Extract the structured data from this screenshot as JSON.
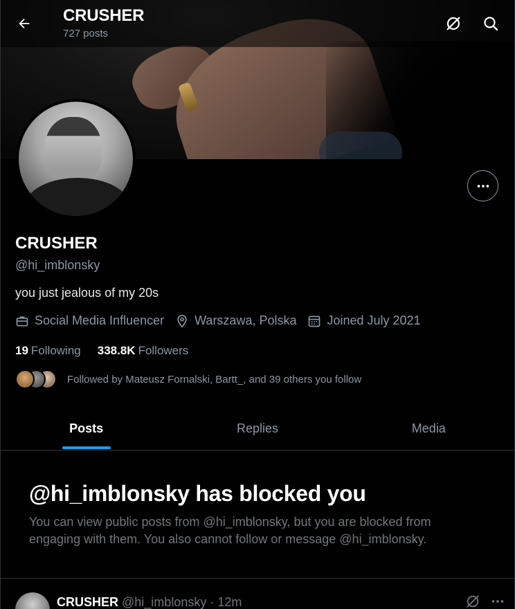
{
  "header": {
    "title": "CRUSHER",
    "post_count": "727 posts",
    "icons": [
      "back-arrow-icon",
      "grok-icon",
      "search-icon"
    ]
  },
  "profile": {
    "display_name": "CRUSHER",
    "handle": "@hi_imblonsky",
    "bio": "you just jealous of my 20s",
    "category": "Social Media Influencer",
    "location": "Warszawa, Polska",
    "joined": "Joined July 2021",
    "following_count": "19",
    "following_label": "Following",
    "followers_count": "338.8K",
    "followers_label": "Followers",
    "followed_by": "Followed by Mateusz Fornalski, Bartt_, and 39 others you follow"
  },
  "tabs": [
    {
      "label": "Posts",
      "active": true
    },
    {
      "label": "Replies",
      "active": false
    },
    {
      "label": "Media",
      "active": false
    }
  ],
  "blocked": {
    "title": "@hi_imblonsky has blocked you",
    "message": "You can view public posts from @hi_imblonsky, but you are blocked from engaging with them. You also cannot follow or message @hi_imblonsky."
  },
  "post": {
    "name": "CRUSHER",
    "handle": "@hi_imblonsky",
    "time": "· 12m"
  },
  "colors": {
    "background": "#000000",
    "accent": "#1d9bf0",
    "muted_text": "#8b98a5",
    "border": "#2f3336"
  }
}
